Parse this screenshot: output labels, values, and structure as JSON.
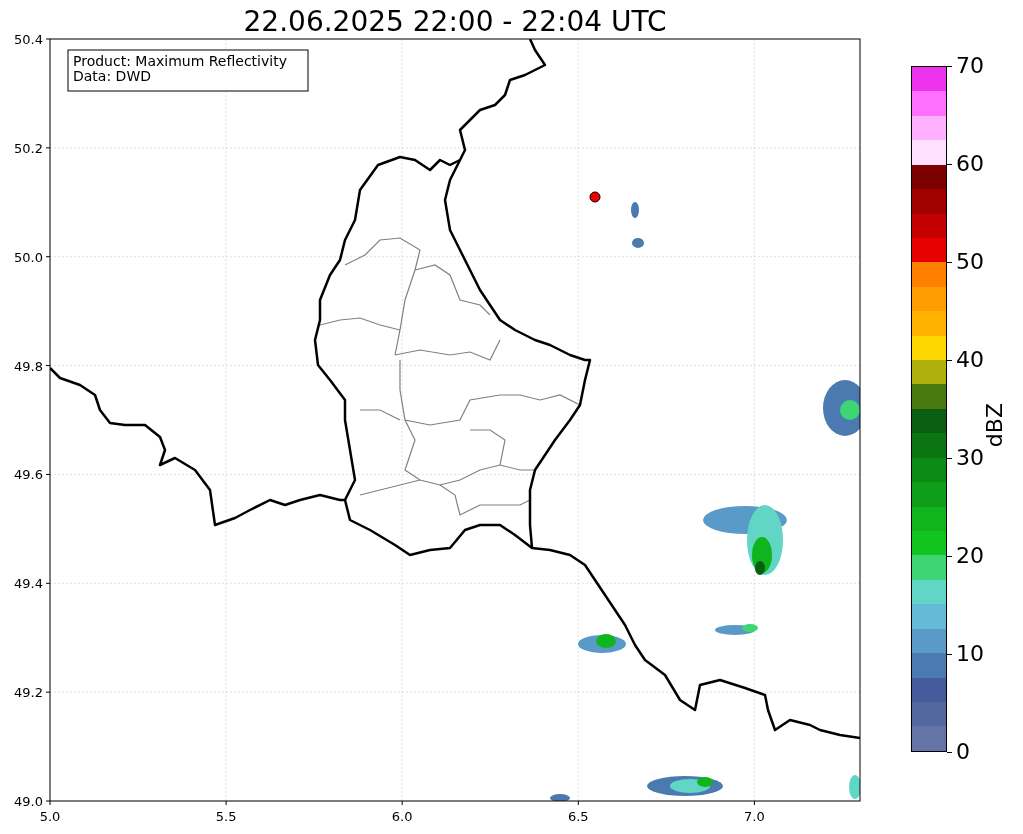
{
  "plot": {
    "title": "22.06.2025 22:00 - 22:04 UTC",
    "info_box": [
      "Product: Maximum Reflectivity",
      "Data: DWD"
    ],
    "xticks": [
      "5.0",
      "5.5",
      "6.0",
      "6.5",
      "7.0"
    ],
    "yticks": [
      "50.4",
      "50.2",
      "50.0",
      "49.8",
      "49.6",
      "49.4",
      "49.2",
      "49.0"
    ]
  },
  "colorbar": {
    "label": "dBZ",
    "ticks": [
      "70",
      "60",
      "50",
      "40",
      "30",
      "20",
      "10",
      "0"
    ],
    "bands": [
      {
        "color": "#ee33ee"
      },
      {
        "color": "#ff70ff"
      },
      {
        "color": "#ffb0ff"
      },
      {
        "color": "#ffe0ff"
      },
      {
        "color": "#7c0000"
      },
      {
        "color": "#a00000"
      },
      {
        "color": "#c50000"
      },
      {
        "color": "#e60000"
      },
      {
        "color": "#ff7f00"
      },
      {
        "color": "#ff9c00"
      },
      {
        "color": "#ffb300"
      },
      {
        "color": "#ffd700"
      },
      {
        "color": "#b0b00c"
      },
      {
        "color": "#497a0f"
      },
      {
        "color": "#0a5e10"
      },
      {
        "color": "#0b7512"
      },
      {
        "color": "#0b8a14"
      },
      {
        "color": "#0f9e18"
      },
      {
        "color": "#10b41c"
      },
      {
        "color": "#12c51e"
      },
      {
        "color": "#3ed674"
      },
      {
        "color": "#62d6c4"
      },
      {
        "color": "#63bbd9"
      },
      {
        "color": "#5a9ac8"
      },
      {
        "color": "#4a7ab0"
      },
      {
        "color": "#445c9e"
      },
      {
        "color": "#53689e"
      },
      {
        "color": "#6475a5"
      }
    ]
  }
}
